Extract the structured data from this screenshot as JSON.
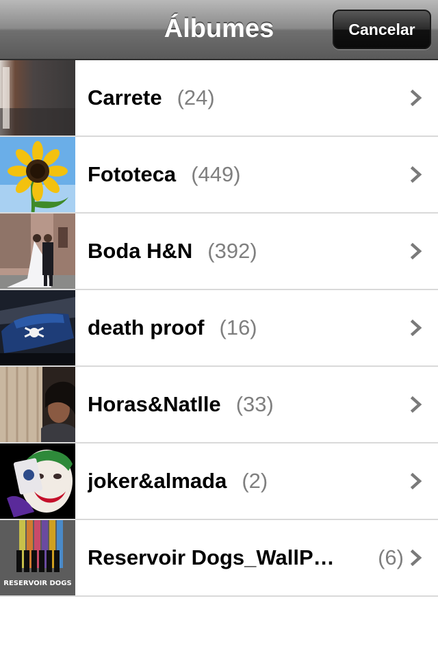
{
  "navbar": {
    "title": "Álbumes",
    "cancel_label": "Cancelar"
  },
  "albums": [
    {
      "name": "Carrete",
      "count": "(24)"
    },
    {
      "name": "Fototeca",
      "count": "(449)"
    },
    {
      "name": "Boda H&N",
      "count": "(392)"
    },
    {
      "name": "death proof",
      "count": "(16)"
    },
    {
      "name": "Horas&Natlle",
      "count": "(33)"
    },
    {
      "name": "joker&almada",
      "count": "(2)"
    },
    {
      "name": "Reservoir Dogs_WallP…",
      "count": "(6)"
    }
  ],
  "thumbnail_text": {
    "reservoir": "RESERVOIR DOGS"
  },
  "icons": {
    "chevron": "chevron-right-icon"
  },
  "colors": {
    "count_gray": "#7f7f7f",
    "chevron_gray": "#7a7a7a"
  }
}
